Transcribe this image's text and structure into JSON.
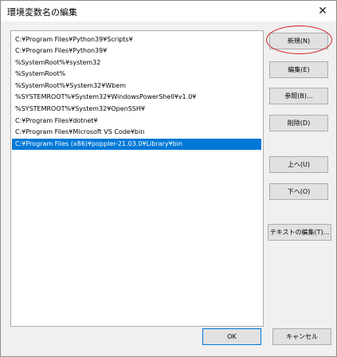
{
  "window": {
    "title": "環境変数名の編集",
    "close_glyph": "✕"
  },
  "list": {
    "items": [
      "C:¥Program Files¥Python39¥Scripts¥",
      "C:¥Program Files¥Python39¥",
      "%SystemRoot%¥system32",
      "%SystemRoot%",
      "%SystemRoot%¥System32¥Wbem",
      "%SYSTEMROOT%¥System32¥WindowsPowerShell¥v1.0¥",
      "%SYSTEMROOT%¥System32¥OpenSSH¥",
      "C:¥Program Files¥dotnet¥",
      "C:¥Program Files¥Microsoft VS Code¥bin",
      "C:¥Program Files (x86)¥poppler-21.03.0¥Library¥bin"
    ],
    "selected_index": 9
  },
  "buttons": {
    "new": "新規(N)",
    "edit": "編集(E)",
    "browse": "参照(B)...",
    "delete": "削除(D)",
    "move_up": "上へ(U)",
    "move_down": "下へ(O)",
    "edit_text": "テキストの編集(T)...",
    "ok": "OK",
    "cancel": "キャンセル"
  },
  "colors": {
    "selection": "#0078d7",
    "annotation": "#d32020"
  }
}
